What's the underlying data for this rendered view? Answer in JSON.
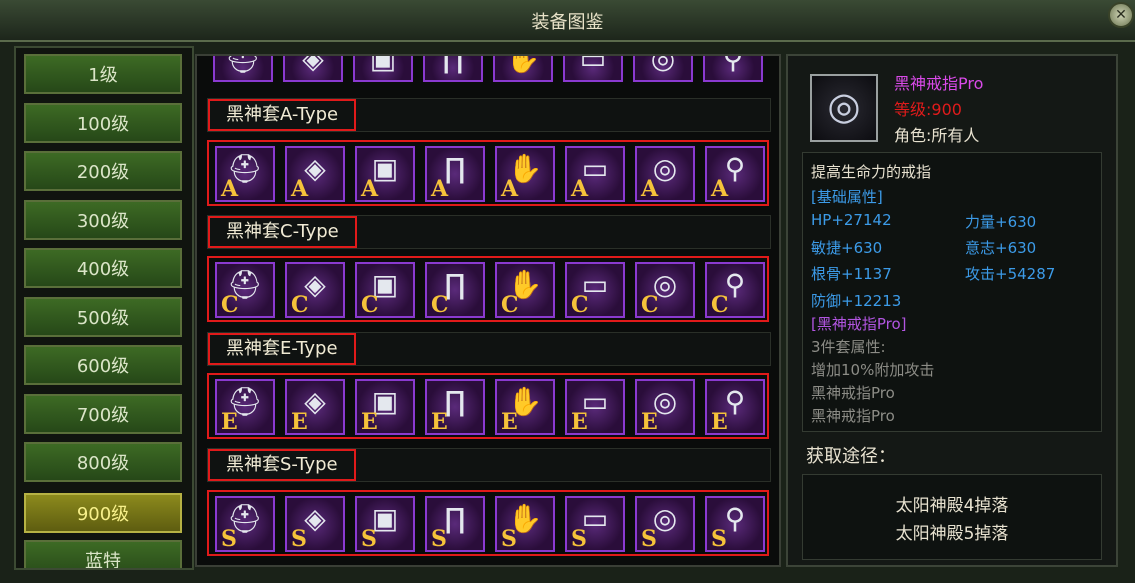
{
  "window": {
    "title": "装备图鉴"
  },
  "levels": [
    "1级",
    "100级",
    "200级",
    "300级",
    "400级",
    "500级",
    "600级",
    "700级",
    "800级",
    "900级",
    "蓝特"
  ],
  "selected_level_index": 9,
  "sets": [
    {
      "label": "黑神套A-Type",
      "grade": "A"
    },
    {
      "label": "黑神套C-Type",
      "grade": "C"
    },
    {
      "label": "黑神套E-Type",
      "grade": "E"
    },
    {
      "label": "黑神套S-Type",
      "grade": "S"
    }
  ],
  "slot_icons": [
    "helmet-icon",
    "amulet-icon",
    "armor-icon",
    "pants-icon",
    "gloves-icon",
    "belt-icon",
    "ring-icon",
    "boots-icon"
  ],
  "item": {
    "name": "黑神戒指Pro",
    "level": "等级:900",
    "role": "角色:所有人",
    "description": "提高生命力的戒指",
    "base_header": "[基础属性]",
    "stats": [
      "HP+27142",
      "力量+630",
      "敏捷+630",
      "意志+630",
      "根骨+1137",
      "攻击+54287",
      "防御+12213"
    ],
    "set_name": "[黑神戒指Pro]",
    "set_bonus_header": "3件套属性:",
    "set_bonus": "增加10%附加攻击",
    "set_members": [
      "黑神戒指Pro",
      "黑神戒指Pro"
    ]
  },
  "source": {
    "title": "获取途径：",
    "lines": [
      "太阳神殿4掉落",
      "太阳神殿5掉落"
    ]
  },
  "colors": {
    "selected_level": "#8c8a1d",
    "highlight_border": "#e11a1a",
    "item_name": "#d94ae8",
    "level_text": "#e01b1b",
    "stat_text": "#3c9be8",
    "grade_letter": "#f5c33a"
  }
}
